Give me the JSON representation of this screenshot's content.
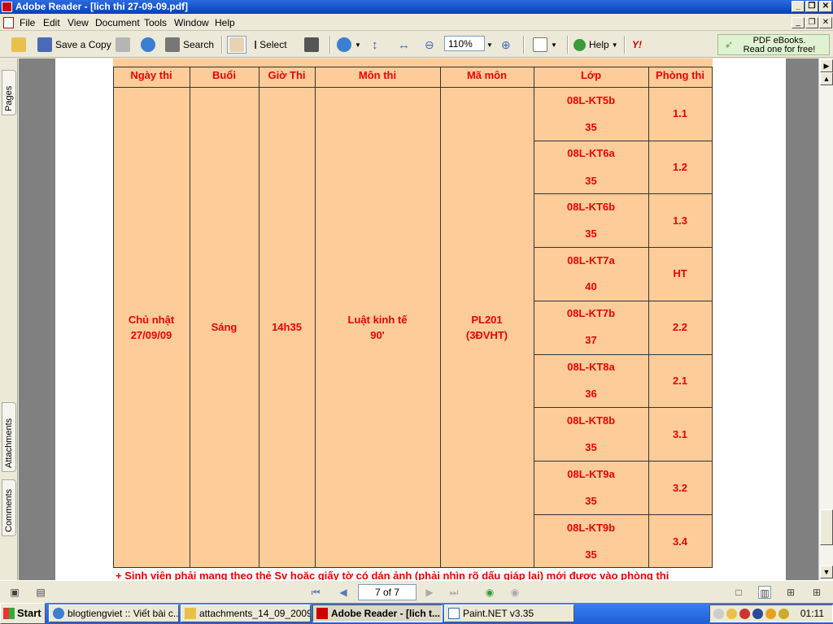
{
  "window": {
    "title": "Adobe Reader - [lich thi 27-09-09.pdf]"
  },
  "menu": [
    "File",
    "Edit",
    "View",
    "Document",
    "Tools",
    "Window",
    "Help"
  ],
  "toolbar": {
    "save_copy": "Save a Copy",
    "search": "Search",
    "select": "Select",
    "zoom": "110%",
    "help": "Help",
    "ebooks_line1": "PDF eBooks.",
    "ebooks_line2": "Read one for free!"
  },
  "side_tabs": [
    "Pages",
    "Attachments",
    "Comments"
  ],
  "schedule": {
    "headers": [
      "Ngày thi",
      "Buổi",
      "Giờ Thi",
      "Môn thi",
      "Mã môn",
      "Lớp",
      "Phòng thi"
    ],
    "date_line1": "Chủ nhật",
    "date_line2": "27/09/09",
    "session": "Sáng",
    "time": "14h35",
    "subject_line1": "Luật kinh tế",
    "subject_line2": "90'",
    "code_line1": "PL201",
    "code_line2": "(3ĐVHT)",
    "rows": [
      {
        "class": "08L-KT5b",
        "count": "35",
        "room": "1.1"
      },
      {
        "class": "08L-KT6a",
        "count": "35",
        "room": "1.2"
      },
      {
        "class": "08L-KT6b",
        "count": "35",
        "room": "1.3"
      },
      {
        "class": "08L-KT7a",
        "count": "40",
        "room": "HT"
      },
      {
        "class": "08L-KT7b",
        "count": "37",
        "room": "2.2"
      },
      {
        "class": "08L-KT8a",
        "count": "36",
        "room": "2.1"
      },
      {
        "class": "08L-KT8b",
        "count": "35",
        "room": "3.1"
      },
      {
        "class": "08L-KT9a",
        "count": "35",
        "room": "3.2"
      },
      {
        "class": "08L-KT9b",
        "count": "35",
        "room": "3.4"
      }
    ],
    "footnote": "+ Sinh viên phải mang theo thẻ Sv hoặc giấy tờ có dán ảnh (phải nhìn rõ dấu giáp lai) mới được vào phòng thi"
  },
  "navigation": {
    "page_indicator": "7 of 7"
  },
  "taskbar": {
    "start": "Start",
    "items": [
      "blogtiengviet :: Viết bài c...",
      "attachments_14_09_2009",
      "Adobe Reader - [lich t...",
      "Paint.NET v3.35"
    ],
    "clock": "01:11"
  },
  "colors": {
    "accent": "#ee0000",
    "table_bg": "#fdcc99",
    "titlebar": "#0a3fb8"
  }
}
